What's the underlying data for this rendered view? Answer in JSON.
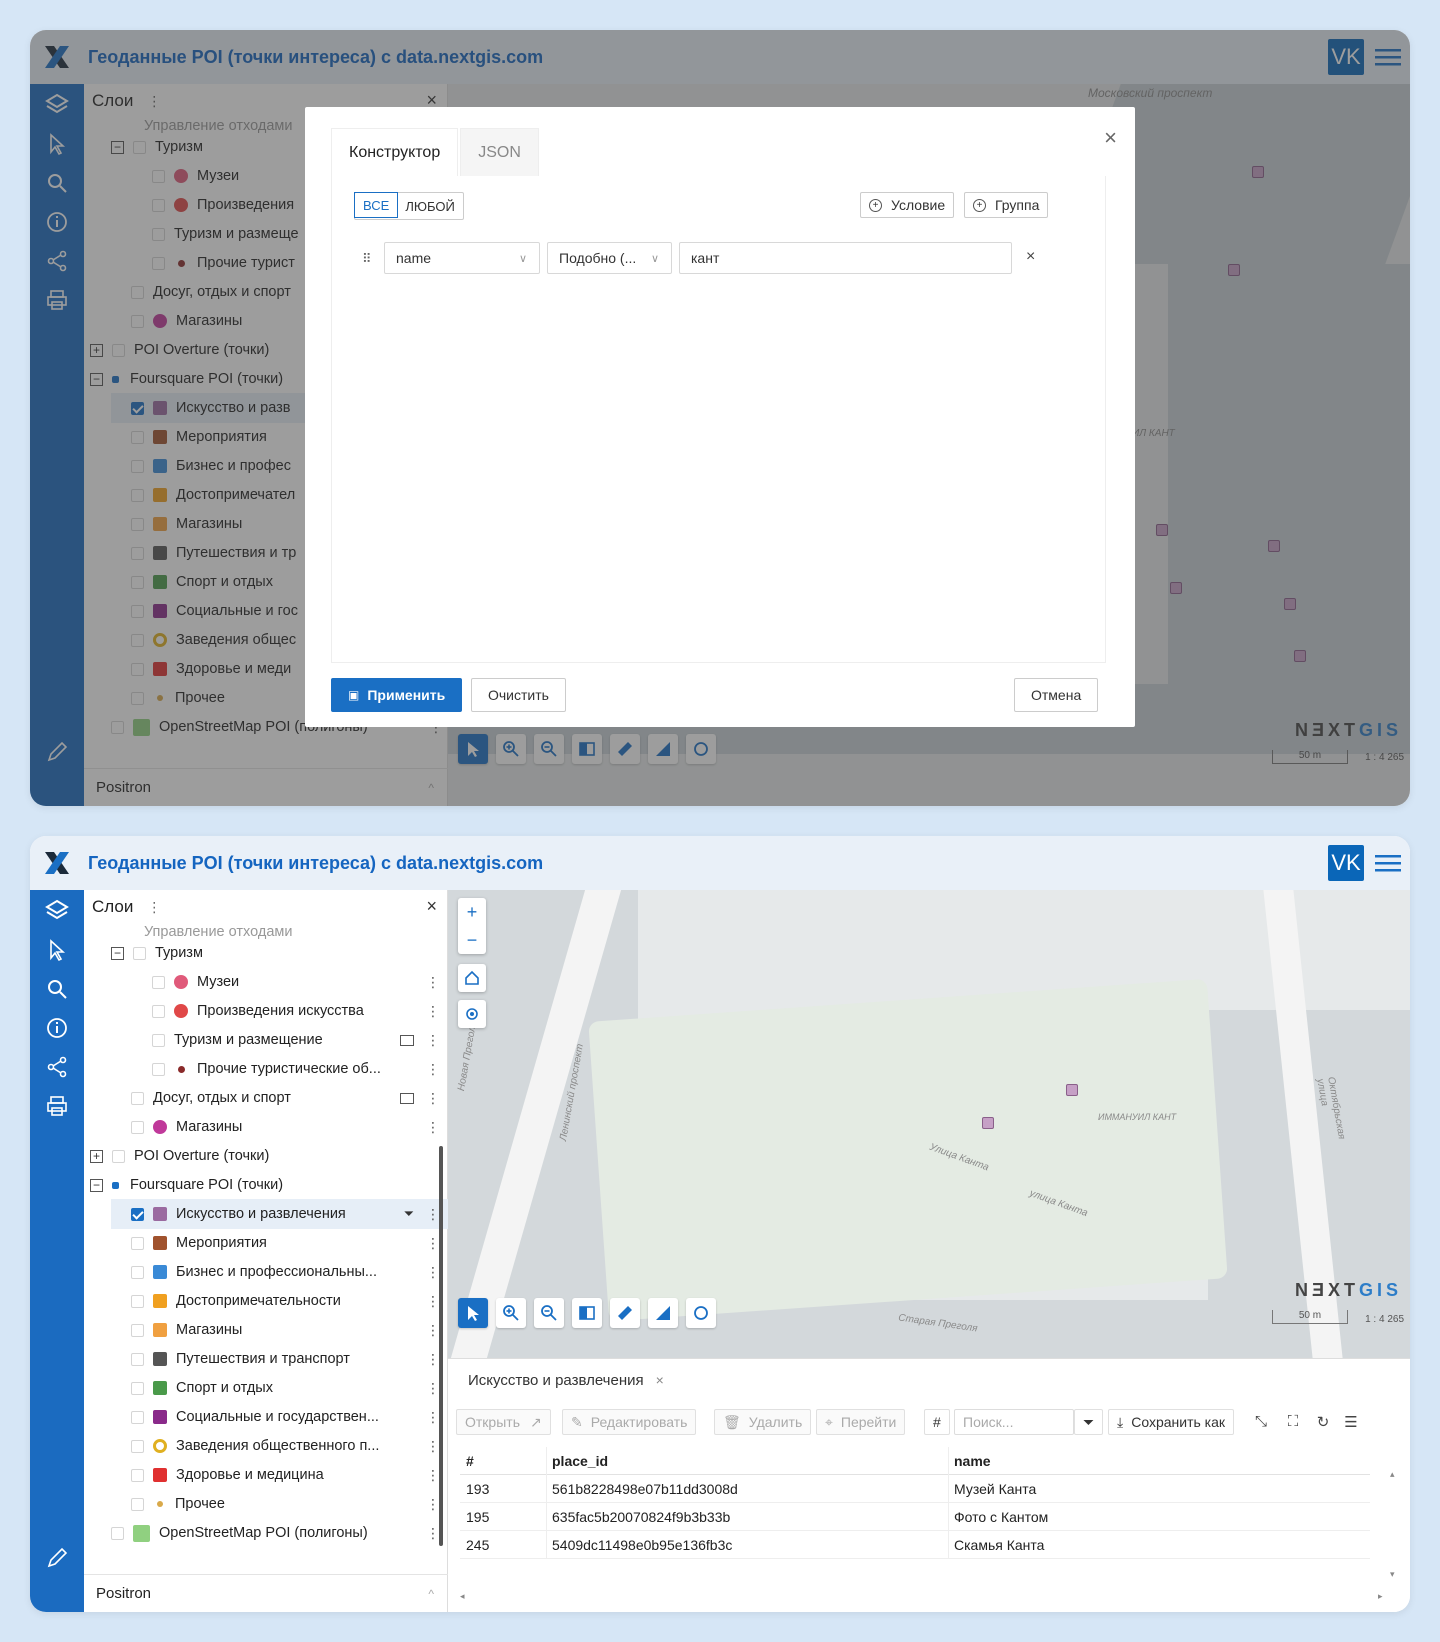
{
  "app": {
    "title": "Геоданные POI (точки интереса) с data.nextgis.com",
    "vk_label": "VK"
  },
  "layers_panel": {
    "title": "Слои",
    "more": "⋮",
    "close": "×",
    "cut_text": "Управление отходами",
    "items": [
      {
        "label": "Туризм"
      },
      {
        "label": "Музеи"
      },
      {
        "label": "Произведения искусства"
      },
      {
        "label": "Туризм и размещение"
      },
      {
        "label": "Прочие туристические об..."
      },
      {
        "label": "Досуг, отдых и спорт"
      },
      {
        "label": "Магазины"
      },
      {
        "label": "POI Overture (точки)"
      },
      {
        "label": "Foursquare POI (точки)"
      },
      {
        "label": "Искусство и развлечения"
      },
      {
        "label": "Мероприятия"
      },
      {
        "label": "Бизнес и профессиональны..."
      },
      {
        "label": "Достопримечательности"
      },
      {
        "label": "Магазины"
      },
      {
        "label": "Путешествия и транспорт"
      },
      {
        "label": "Спорт и отдых"
      },
      {
        "label": "Социальные и государствен..."
      },
      {
        "label": "Заведения общественного п..."
      },
      {
        "label": "Здоровье и медицина"
      },
      {
        "label": "Прочее"
      },
      {
        "label": "OpenStreetMap POI (полигоны)"
      }
    ],
    "basemap": "Positron"
  },
  "top_items_window1": [
    "Туризм",
    "Музеи",
    "Произведения",
    "Туризм и размеще",
    "Прочие турист",
    "Досуг, отдых и спорт",
    "Магазины",
    "POI Overture (точки)",
    "Foursquare POI (точки)",
    "Искусство и разв",
    "Мероприятия",
    "Бизнес и профес",
    "Достопримечател",
    "Магазины",
    "Путешествия и тр",
    "Спорт и отдых",
    "Социальные и гос",
    "Заведения общес",
    "Здоровье и меди",
    "Прочее",
    "OpenStreetMap POI (полигоны)"
  ],
  "filter_dialog": {
    "tabs": [
      "Конструктор",
      "JSON"
    ],
    "mode_all": "ВСЕ",
    "mode_any": "ЛЮБОЙ",
    "add_condition": "Условие",
    "add_group": "Группа",
    "condition": {
      "field": "name",
      "operator": "Подобно (...",
      "value": "кант"
    },
    "apply": "Применить",
    "clear": "Очистить",
    "cancel": "Отмена",
    "close": "×"
  },
  "map": {
    "logo_a": "N",
    "logo_b": "Ǝ",
    "logo_c": "XT",
    "logo_d": "GIS",
    "scale_bar": "50 m",
    "scale_ratio": "1 : 4 265",
    "streets": {
      "leninsky": "Ленинский проспект",
      "moskovsky": "Московский проспект",
      "oktyabrskaya": "Октябрьская улица",
      "kanta1": "Улица Канта",
      "kanta2": "улица Канта",
      "novaya_pregolya": "Новая Преголя",
      "staraya_pregolya": "Старая Преголя",
      "kant_label": "ИММАНУИЛ КАНТ",
      "naberezhnaya": "Стапрегольская набережная"
    }
  },
  "attribute_table": {
    "tab_label": "Искусство и развлечения",
    "tab_close": "×",
    "tools": {
      "open": "Открыть",
      "edit": "Редактировать",
      "delete": "Удалить",
      "goto": "Перейти",
      "hash": "#",
      "save_as": "Сохранить как"
    },
    "search_placeholder": "Поиск...",
    "columns": [
      "#",
      "place_id",
      "name"
    ],
    "rows": [
      {
        "id": "193",
        "place_id": "561b8228498e07b11dd3008d",
        "name": "Музей Канта"
      },
      {
        "id": "195",
        "place_id": "635fac5b20070824f9b3b33b",
        "name": "Фото с Кантом"
      },
      {
        "id": "245",
        "place_id": "5409dc11498e0b95e136fb3c",
        "name": "Скамья Канта"
      }
    ]
  },
  "colors": {
    "accent": "#1a6fc4",
    "sidebar": "#1b6bc0",
    "title": "#1565c0"
  }
}
